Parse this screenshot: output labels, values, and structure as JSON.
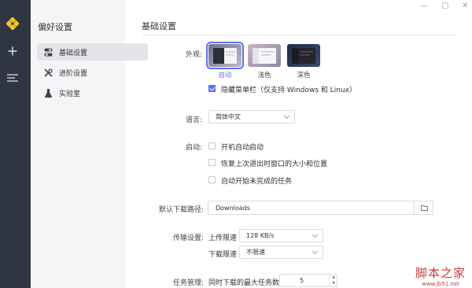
{
  "rail": {
    "icons": [
      "logo-icon",
      "plus-icon",
      "menu-icon"
    ]
  },
  "nav": {
    "title": "偏好设置",
    "items": [
      {
        "label": "基础设置",
        "icon": "sliders-icon",
        "active": true
      },
      {
        "label": "进阶设置",
        "icon": "tools-icon",
        "active": false
      },
      {
        "label": "实验室",
        "icon": "flask-icon",
        "active": false
      }
    ]
  },
  "window": {
    "minimize": "—",
    "maximize": "▢",
    "close": "✕"
  },
  "main": {
    "section_title": "基础设置",
    "appearance": {
      "label": "外观:",
      "themes": [
        {
          "label": "自动",
          "selected": true
        },
        {
          "label": "浅色",
          "selected": false
        },
        {
          "label": "深色",
          "selected": false
        }
      ],
      "hide_menubar": {
        "label": "隐藏菜单栏（仅支持 Windows 和 Linux）",
        "checked": true
      }
    },
    "language": {
      "label": "语言:",
      "value": "简体中文"
    },
    "startup": {
      "label": "启动:",
      "options": [
        {
          "label": "开机自动启动",
          "checked": false
        },
        {
          "label": "恢复上次退出时窗口的大小和位置",
          "checked": false
        },
        {
          "label": "自动开始未完成的任务",
          "checked": false
        }
      ]
    },
    "download_path": {
      "label": "默认下载路径:",
      "value": "Downloads"
    },
    "transfer": {
      "label": "传输设置:",
      "upload_label": "上传限速",
      "upload_value": "128 KB/s",
      "download_label": "下载限速",
      "download_value": "不限速"
    },
    "tasks": {
      "label": "任务管理:",
      "max_label": "同时下载的最大任务数",
      "max_value": "5"
    }
  },
  "watermark": {
    "main": "脚本之家",
    "url": "www.jb51.net"
  },
  "colors": {
    "accent": "#5b73e8",
    "rail_bg": "#303641",
    "nav_bg": "#f4f5f7",
    "watermark": "#c8383a"
  }
}
